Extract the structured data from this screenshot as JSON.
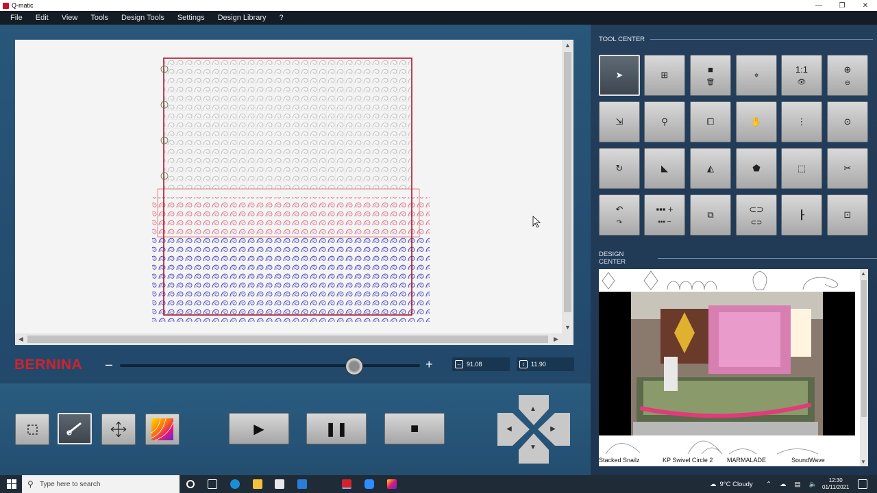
{
  "window": {
    "title": "Q-matic",
    "minimize": "—",
    "restore": "❐",
    "close": "✕"
  },
  "menu": [
    "File",
    "Edit",
    "View",
    "Tools",
    "Design Tools",
    "Settings",
    "Design Library",
    "?"
  ],
  "brand": "BERNINA",
  "zoom": {
    "minus": "–",
    "plus": "+",
    "level": 0.78
  },
  "coords": {
    "width_value": "91.08",
    "height_value": "11.90"
  },
  "scroll": {
    "up": "▲",
    "down": "▼",
    "left": "◀",
    "right": "▶"
  },
  "bottom_tools": [
    "crop",
    "stitch-path",
    "move",
    "color-gradient"
  ],
  "transport": {
    "play": "▶",
    "pause": "❚❚",
    "stop": "■"
  },
  "arrows": {
    "up": "▲",
    "down": "▼",
    "left": "◀",
    "right": "▶"
  },
  "tool_center": {
    "title": "TOOL CENTER",
    "tools": [
      {
        "name": "select-icon",
        "glyph": "➤",
        "glyph2": ""
      },
      {
        "name": "add-design-icon",
        "glyph": "⊞",
        "glyph2": ""
      },
      {
        "name": "copy-delete-icon",
        "glyph": "■",
        "glyph2": "🗑"
      },
      {
        "name": "target-icon",
        "glyph": "⌖",
        "glyph2": ""
      },
      {
        "name": "view-icon",
        "glyph": "1:1",
        "glyph2": "👁"
      },
      {
        "name": "zoom-icon",
        "glyph": "⊕",
        "glyph2": "⊖"
      },
      {
        "name": "resize-icon",
        "glyph": "⇲",
        "glyph2": ""
      },
      {
        "name": "measure-icon",
        "glyph": "⚲",
        "glyph2": ""
      },
      {
        "name": "crop-icon",
        "glyph": "⧠",
        "glyph2": ""
      },
      {
        "name": "hand-icon",
        "glyph": "✋",
        "glyph2": ""
      },
      {
        "name": "sequence-icon",
        "glyph": "⋮",
        "glyph2": ""
      },
      {
        "name": "group-icon",
        "glyph": "⊙",
        "glyph2": ""
      },
      {
        "name": "rotate-icon",
        "glyph": "↻",
        "glyph2": ""
      },
      {
        "name": "skew-icon",
        "glyph": "◣",
        "glyph2": ""
      },
      {
        "name": "mirror-icon",
        "glyph": "◭",
        "glyph2": ""
      },
      {
        "name": "shape-icon",
        "glyph": "⬟",
        "glyph2": ""
      },
      {
        "name": "distort-icon",
        "glyph": "⬚",
        "glyph2": ""
      },
      {
        "name": "scissors-icon",
        "glyph": "✂",
        "glyph2": ""
      },
      {
        "name": "undo-redo-icon",
        "glyph": "↶",
        "glyph2": "↷"
      },
      {
        "name": "repeat-icon",
        "glyph": "▪▪▪ +",
        "glyph2": "▪▪▪ −"
      },
      {
        "name": "layer-icon",
        "glyph": "⧉",
        "glyph2": ""
      },
      {
        "name": "link-icon",
        "glyph": "⊂⊃",
        "glyph2": "⊂⊃"
      },
      {
        "name": "align-icon",
        "glyph": "┠",
        "glyph2": ""
      },
      {
        "name": "fit-icon",
        "glyph": "⊡",
        "glyph2": ""
      }
    ]
  },
  "design_center": {
    "title": "DESIGN CENTER",
    "labels": [
      "Stacked Snailz",
      "KP Swivel Circle 2",
      "MARMALADE",
      "SoundWave"
    ]
  },
  "taskbar": {
    "search_placeholder": "Type here to search",
    "weather": "9°C  Cloudy",
    "time": "12:30",
    "date": "01/11/2021"
  },
  "colors": {
    "accent_red": "#d3212d",
    "design_red": "#c0304a",
    "design_blue": "#2c2da8",
    "panel": "#243f5c"
  }
}
